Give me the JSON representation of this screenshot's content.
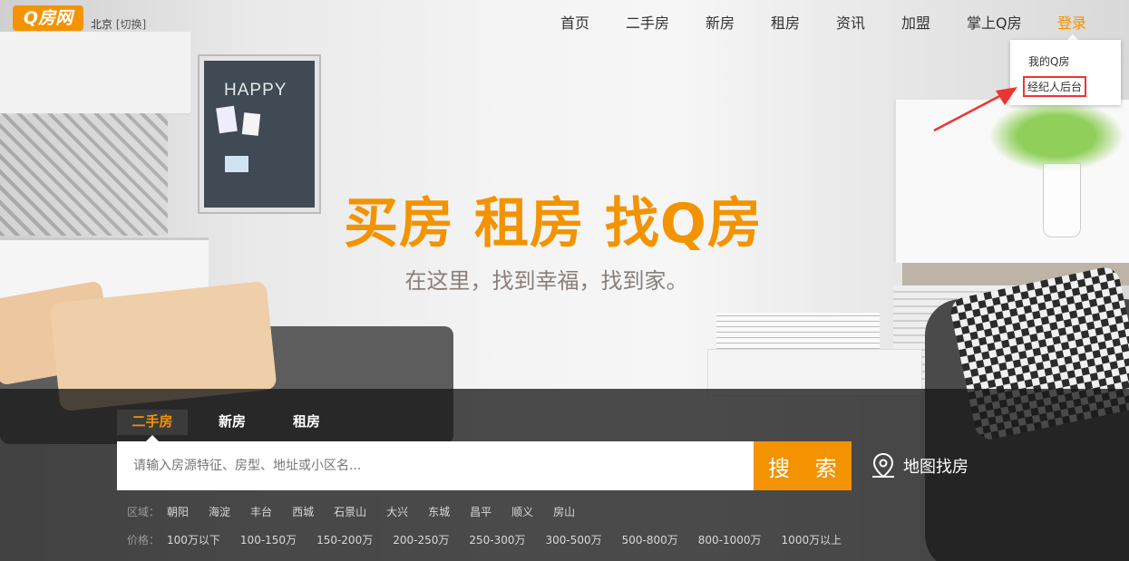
{
  "header": {
    "logo_text": "Q房网",
    "city": "北京",
    "city_switch": "[切换]"
  },
  "nav": {
    "items": [
      "首页",
      "二手房",
      "新房",
      "租房",
      "资讯",
      "加盟",
      "掌上Q房"
    ],
    "login": "登录"
  },
  "dropdown": {
    "items": [
      "我的Q房",
      "经纪人后台"
    ],
    "highlight_color": "#e33333"
  },
  "decor": {
    "board_text": "HAPPY"
  },
  "hero": {
    "slogan": "买房 租房 找Q房",
    "subtitle": "在这里，找到幸福，找到家。"
  },
  "search": {
    "tabs": [
      "二手房",
      "新房",
      "租房"
    ],
    "active_tab": "二手房",
    "placeholder": "请输入房源特征、房型、地址或小区名...",
    "button_label": "搜 索",
    "map_link": "地图找房"
  },
  "filters": {
    "area_label": "区域：",
    "areas": [
      "朝阳",
      "海淀",
      "丰台",
      "西城",
      "石景山",
      "大兴",
      "东城",
      "昌平",
      "顺义",
      "房山"
    ],
    "price_label": "价格：",
    "prices": [
      "100万以下",
      "100-150万",
      "150-200万",
      "200-250万",
      "250-300万",
      "300-500万",
      "500-800万",
      "800-1000万",
      "1000万以上"
    ]
  },
  "colors": {
    "accent": "#f39300",
    "panel": "#1f1f1f"
  }
}
